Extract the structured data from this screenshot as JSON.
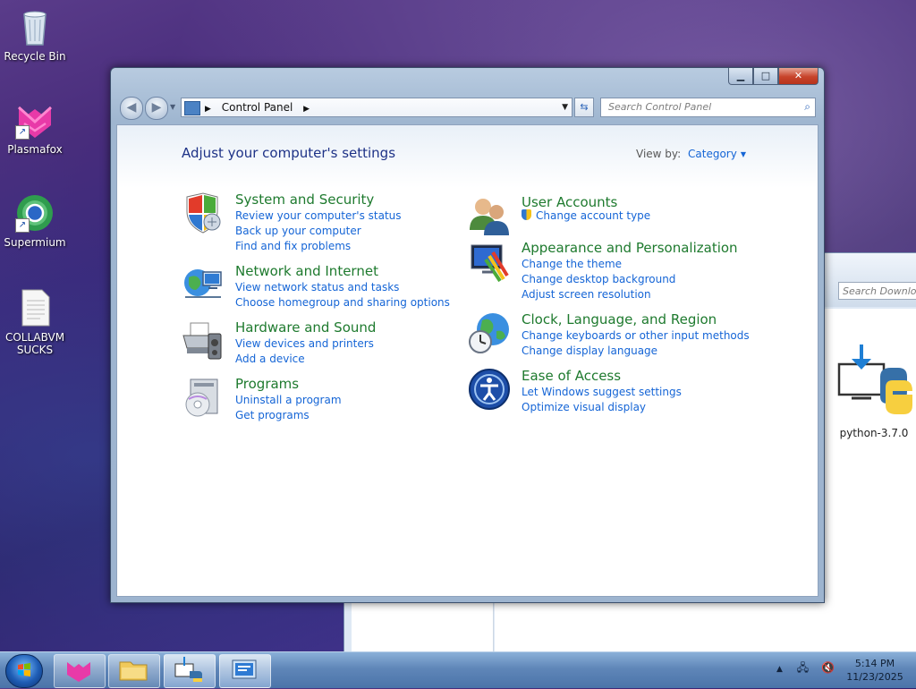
{
  "desktop": {
    "icons": [
      {
        "label": "Recycle Bin"
      },
      {
        "label": "Plasmafox"
      },
      {
        "label": "Supermium"
      },
      {
        "label": "COLLABVM SUCKS"
      }
    ]
  },
  "background_window": {
    "search_placeholder": "Search Downloads",
    "file_label": "python-3.7.0"
  },
  "window": {
    "address": {
      "crumb": "Control Panel"
    },
    "search_placeholder": "Search Control Panel",
    "content_title": "Adjust your computer's settings",
    "view_by_label": "View by:",
    "view_by_value": "Category",
    "groups": [
      {
        "title": "System and Security",
        "icon": "shield-icon",
        "links": [
          "Review your computer's status",
          "Back up your computer",
          "Find and fix problems"
        ]
      },
      {
        "title": "Network and Internet",
        "icon": "globe-network-icon",
        "links": [
          "View network status and tasks",
          "Choose homegroup and sharing options"
        ]
      },
      {
        "title": "Hardware and Sound",
        "icon": "printer-speaker-icon",
        "links": [
          "View devices and printers",
          "Add a device"
        ]
      },
      {
        "title": "Programs",
        "icon": "programs-cd-icon",
        "links": [
          "Uninstall a program",
          "Get programs"
        ]
      },
      {
        "title": "User Accounts",
        "icon": "users-icon",
        "links": [
          "Change account type"
        ]
      },
      {
        "title": "Appearance and Personalization",
        "icon": "monitor-palette-icon",
        "links": [
          "Change the theme",
          "Change desktop background",
          "Adjust screen resolution"
        ]
      },
      {
        "title": "Clock, Language, and Region",
        "icon": "globe-clock-icon",
        "links": [
          "Change keyboards or other input methods",
          "Change display language"
        ]
      },
      {
        "title": "Ease of Access",
        "icon": "ease-of-access-icon",
        "links": [
          "Let Windows suggest settings",
          "Optimize visual display"
        ]
      }
    ]
  },
  "taskbar": {
    "clock": {
      "time": "5:14 PM",
      "date": "11/23/2025"
    }
  },
  "colors": {
    "link": "#1565d6",
    "group_title": "#1e7a2e",
    "heading": "#1e3287"
  }
}
